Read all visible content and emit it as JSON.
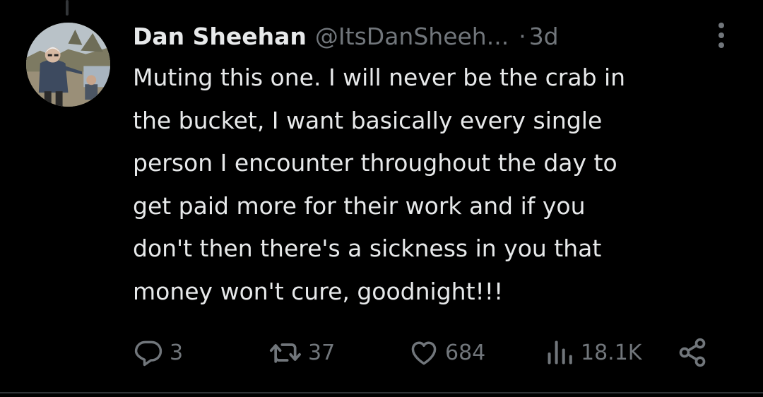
{
  "tweet": {
    "author_name": "Dan Sheehan",
    "handle": "@ItsDanSheeh...",
    "separator": "·",
    "time": "3d",
    "text": "Muting this one. I will never be the crab in\nthe bucket, I want basically every single\nperson I encounter throughout the day to\nget paid more for their work and if you\ndon't then there's a sickness in you that\nmoney won't cure, goodnight!!!"
  },
  "actions": {
    "replies": "3",
    "reposts": "37",
    "likes": "684",
    "views": "18.1K"
  },
  "icons": {
    "reply": "reply-icon",
    "repost": "repost-icon",
    "like": "heart-icon",
    "views": "views-icon",
    "share": "share-icon",
    "more": "more-vertical-icon"
  },
  "colors": {
    "background": "#000000",
    "text": "#e7e9ea",
    "muted": "#71767b",
    "divider": "#2f3336"
  }
}
